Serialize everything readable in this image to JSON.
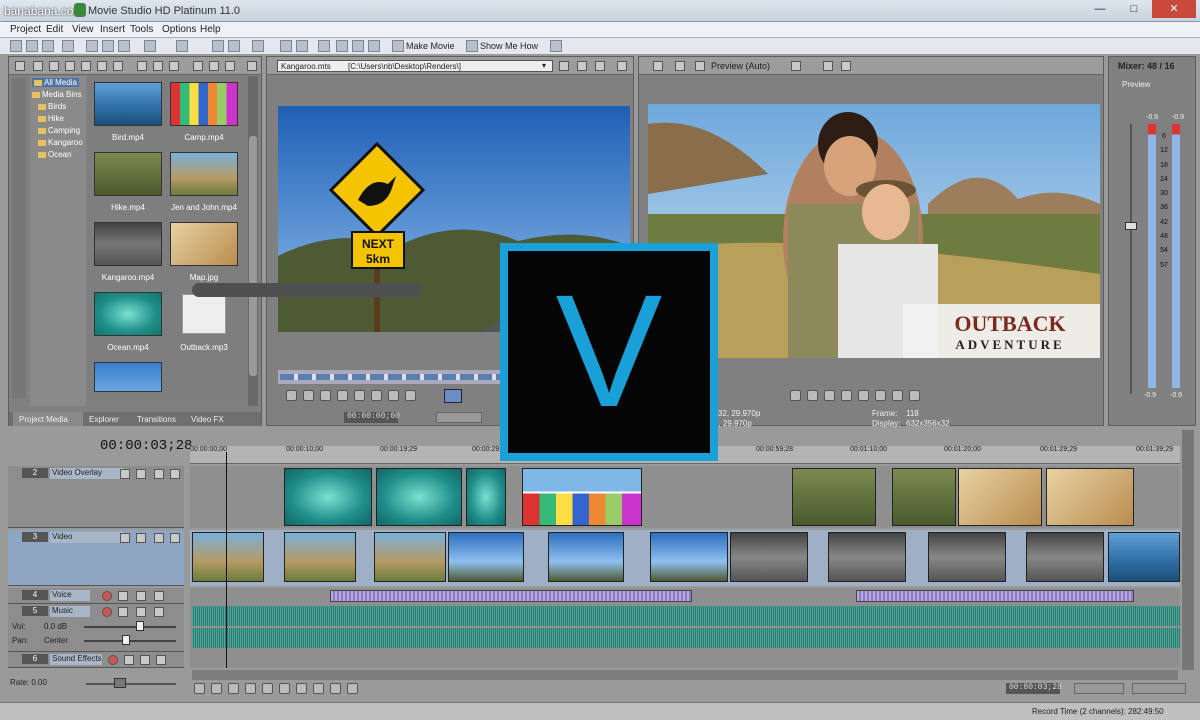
{
  "watermark": "banabana.com",
  "app_title": "Movie Studio HD Platinum 11.0",
  "window": {
    "minimize": "—",
    "maximize": "□",
    "close": "✕"
  },
  "menu": [
    "Project",
    "Edit",
    "View",
    "Insert",
    "Tools",
    "Options",
    "Help"
  ],
  "toolbar": {
    "make_movie": "Make Movie",
    "show_me_how": "Show Me How"
  },
  "media_tree": {
    "all_media": "All Media",
    "media_bins": "Media Bins",
    "bins": [
      "Birds",
      "Hike",
      "Camping",
      "Kangaroo",
      "Ocean"
    ]
  },
  "media_files": [
    "Bird.mp4",
    "Camp.mp4",
    "Hike.mp4",
    "Jen and John.mp4",
    "Kangaroo.mp4",
    "Map.jpg",
    "Ocean.mp4",
    "Outback.mp3"
  ],
  "left_tabs": [
    "Project Media",
    "Explorer",
    "Transitions",
    "Video FX"
  ],
  "trimmer": {
    "file": "Kangaroo.mts",
    "path": "[C:\\Users\\nb\\Desktop\\Renders\\]",
    "timecode": "00:00:00;00"
  },
  "sign": {
    "next": "NEXT",
    "distance": "5km"
  },
  "preview": {
    "mode": "Preview (Auto)",
    "project_left": "x32, 29.970p",
    "display_left": "2, 29.970p",
    "frame_label": "Frame:",
    "frame_value": "118",
    "display_label": "Display:",
    "display_value": "632x356x32"
  },
  "outback": {
    "line1": "OUTBACK",
    "line2": "ADVENTURE"
  },
  "mixer": {
    "title": "Mixer: 48 / 16",
    "preview": "Preview",
    "left_peak": "-0.9",
    "right_peak": "-0.9",
    "scale": [
      "6",
      "12",
      "18",
      "24",
      "30",
      "36",
      "42",
      "48",
      "54",
      "57"
    ],
    "bottom_left": "-0.9",
    "bottom_right": "-0.9"
  },
  "logo": {
    "letter": "V"
  },
  "timeline": {
    "cursor": "00:00:03;28",
    "ruler": [
      "00:00:00;00",
      "00:00:10;00",
      "00:00:19;29",
      "00:00:29;",
      "00:00:59;28",
      "00:01:10;00",
      "00:01:20;00",
      "00:01:29;29",
      "00:01:39;29"
    ],
    "tracks": [
      {
        "num": "2",
        "name": "Video Overlay"
      },
      {
        "num": "3",
        "name": "Video"
      },
      {
        "num": "4",
        "name": "Voice"
      },
      {
        "num": "5",
        "name": "Music"
      },
      {
        "num": "6",
        "name": "Sound Effects"
      }
    ],
    "vol_label": "Vol:",
    "vol_value": "0.0 dB",
    "pan_label": "Pan:",
    "pan_value": "Center",
    "rate": "Rate: 0.00",
    "bottom_timecode": "00:00:03;28",
    "record_time": "Record Time (2 channels): 282:49:50"
  }
}
